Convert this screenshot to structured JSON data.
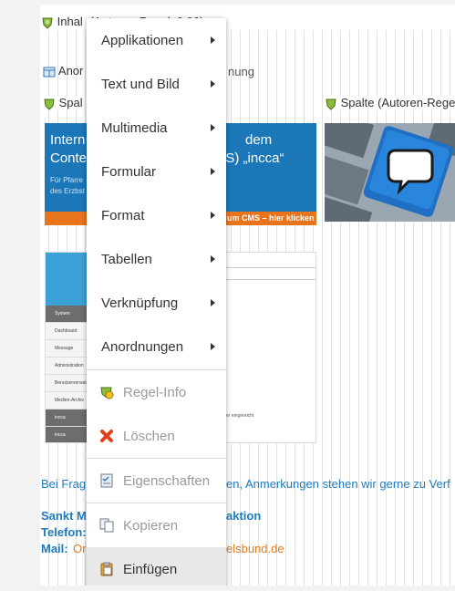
{
  "tree": {
    "inhalt_label": "Inhal",
    "inhalt_suffix": "(Autoren-Regel: 0.90)",
    "anord_label": "Anor",
    "anord_suffix": "nung",
    "col1_label": "Spal",
    "col2_label": "Spalte (Autoren-Regel"
  },
  "teaser": {
    "line1a": "Intern",
    "line1b": "dem",
    "line2a": "Conte",
    "line2b": "(CMS) „incca“",
    "small1": "Für Pfarre",
    "small2": "des Erzbst",
    "orange_text": "um CMS – hier klicken"
  },
  "cms": {
    "items": [
      "System",
      "Dashboard",
      "Message",
      "Administration",
      "Benutzerverwaltung",
      "Medien-Archiv",
      "incca",
      "incca",
      "Info System"
    ],
    "note": "Leiter eingereicht"
  },
  "footer": {
    "line1a": "Bei Frag",
    "line1b": "en, Anmerkungen stehen wir gerne zu Verf",
    "line2a": "Sankt M",
    "line2b": "aktion",
    "line3a": "Telefon:",
    "line4a": "Mail:",
    "line4b": "Or",
    "line4c": "elsbund.de"
  },
  "menu": {
    "items": [
      {
        "label": "Applikationen",
        "submenu": true
      },
      {
        "label": "Text und Bild",
        "submenu": true
      },
      {
        "label": "Multimedia",
        "submenu": true
      },
      {
        "label": "Formular",
        "submenu": true
      },
      {
        "label": "Format",
        "submenu": true
      },
      {
        "label": "Tabellen",
        "submenu": true
      },
      {
        "label": "Verknüpfung",
        "submenu": true
      },
      {
        "label": "Anordnungen",
        "submenu": true
      },
      {
        "label": "Regel-Info",
        "icon": "rule-icon",
        "disabled": true
      },
      {
        "label": "Löschen",
        "icon": "delete-x-icon",
        "disabled": true
      },
      {
        "label": "Eigenschaften",
        "icon": "properties-icon",
        "disabled": true
      },
      {
        "label": "Kopieren",
        "icon": "copy-icon",
        "disabled": true
      },
      {
        "label": "Einfügen",
        "icon": "paste-icon",
        "disabled": false,
        "active": true
      }
    ]
  }
}
